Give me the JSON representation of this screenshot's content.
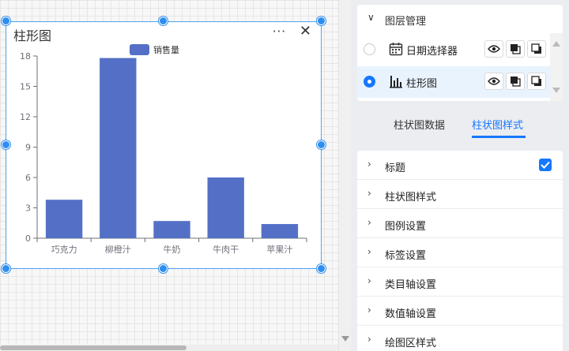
{
  "canvas": {
    "widget": {
      "title": "柱形图",
      "more_glyph": "···",
      "close_glyph": "✕"
    }
  },
  "chart_data": {
    "type": "bar",
    "categories": [
      "巧克力",
      "柳橙汁",
      "牛奶",
      "牛肉干",
      "苹果汁"
    ],
    "series": [
      {
        "name": "销售量",
        "values": [
          3.8,
          17.8,
          1.7,
          6.0,
          1.4
        ],
        "color": "#5470c6"
      }
    ],
    "ylim": [
      0,
      18
    ],
    "yticks": [
      0,
      3,
      6,
      9,
      12,
      15,
      18
    ],
    "grid": false,
    "legend": "top-center"
  },
  "layer_panel": {
    "title": "图层管理",
    "layers": [
      {
        "label": "日期选择器",
        "selected": false,
        "icon": "calendar-icon"
      },
      {
        "label": "柱形图",
        "selected": true,
        "icon": "bar-chart-icon"
      }
    ]
  },
  "tabs": [
    {
      "label": "柱状图数据",
      "active": false
    },
    {
      "label": "柱状图样式",
      "active": true
    }
  ],
  "settings": [
    {
      "label": "标题",
      "checked": true
    },
    {
      "label": "柱状图样式"
    },
    {
      "label": "图例设置"
    },
    {
      "label": "标签设置"
    },
    {
      "label": "类目轴设置"
    },
    {
      "label": "数值轴设置"
    },
    {
      "label": "绘图区样式"
    }
  ],
  "colors": {
    "accent": "#1677ff",
    "bar": "#5470c6",
    "selection": "#2e8ef0"
  }
}
